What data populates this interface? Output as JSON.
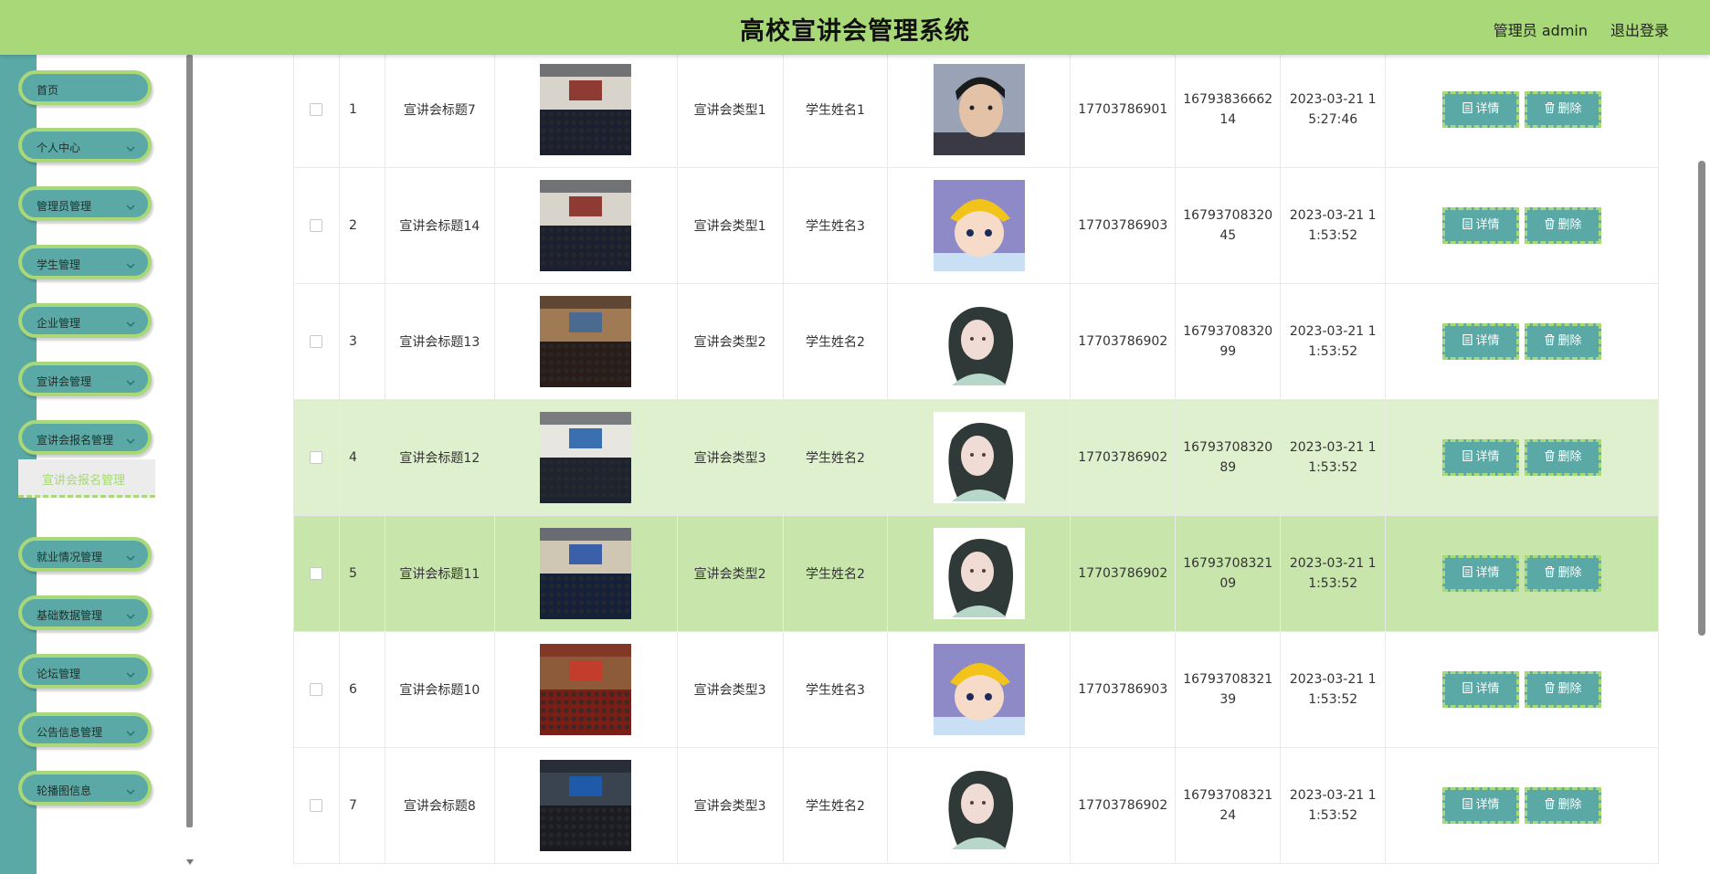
{
  "header": {
    "title": "高校宣讲会管理系统",
    "user": "管理员 admin",
    "logout": "退出登录"
  },
  "sidebar": {
    "items": [
      {
        "label": "首页",
        "has_chevron": false
      },
      {
        "label": "个人中心",
        "has_chevron": true
      },
      {
        "label": "管理员管理",
        "has_chevron": true
      },
      {
        "label": "学生管理",
        "has_chevron": true
      },
      {
        "label": "企业管理",
        "has_chevron": true
      },
      {
        "label": "宣讲会管理",
        "has_chevron": true
      },
      {
        "label": "宣讲会报名管理",
        "has_chevron": true
      },
      {
        "label": "就业情况管理",
        "has_chevron": true
      },
      {
        "label": "基础数据管理",
        "has_chevron": true
      },
      {
        "label": "论坛管理",
        "has_chevron": true
      },
      {
        "label": "公告信息管理",
        "has_chevron": true
      },
      {
        "label": "轮播图信息",
        "has_chevron": true
      }
    ],
    "active_submenu": "宣讲会报名管理"
  },
  "table": {
    "rows": [
      {
        "index": "1",
        "title": "宣讲会标题7",
        "type": "宣讲会类型1",
        "student": "学生姓名1",
        "phone": "17703786901",
        "id": "1679383666214",
        "time": "2023-03-21 15:27:46",
        "highlight": "none",
        "venue_image": "auditorium-photo",
        "avatar_image": "young-man-avatar"
      },
      {
        "index": "2",
        "title": "宣讲会标题14",
        "type": "宣讲会类型1",
        "student": "学生姓名3",
        "phone": "17703786903",
        "id": "1679370832045",
        "time": "2023-03-21 11:53:52",
        "highlight": "none",
        "venue_image": "auditorium-photo",
        "avatar_image": "cartoon-boy-yellow-hat-avatar"
      },
      {
        "index": "3",
        "title": "宣讲会标题13",
        "type": "宣讲会类型2",
        "student": "学生姓名2",
        "phone": "17703786902",
        "id": "1679370832099",
        "time": "2023-03-21 11:53:52",
        "highlight": "none",
        "venue_image": "lecture-hall-photo",
        "avatar_image": "anime-girl-avatar"
      },
      {
        "index": "4",
        "title": "宣讲会标题12",
        "type": "宣讲会类型3",
        "student": "学生姓名2",
        "phone": "17703786902",
        "id": "1679370832089",
        "time": "2023-03-21 11:53:52",
        "highlight": "light",
        "venue_image": "crowded-hall-photo",
        "avatar_image": "anime-girl-avatar"
      },
      {
        "index": "5",
        "title": "宣讲会标题11",
        "type": "宣讲会类型2",
        "student": "学生姓名2",
        "phone": "17703786902",
        "id": "1679370832109",
        "time": "2023-03-21 11:53:52",
        "highlight": "strong",
        "venue_image": "large-auditorium-photo",
        "avatar_image": "anime-girl-avatar"
      },
      {
        "index": "6",
        "title": "宣讲会标题10",
        "type": "宣讲会类型3",
        "student": "学生姓名3",
        "phone": "17703786903",
        "id": "1679370832139",
        "time": "2023-03-21 11:53:52",
        "highlight": "none",
        "venue_image": "red-seats-hall-photo",
        "avatar_image": "cartoon-boy-yellow-hat-avatar"
      },
      {
        "index": "7",
        "title": "宣讲会标题8",
        "type": "宣讲会类型3",
        "student": "学生姓名2",
        "phone": "17703786902",
        "id": "1679370832124",
        "time": "2023-03-21 11:53:52",
        "highlight": "none",
        "venue_image": "stage-banner-photo",
        "avatar_image": "anime-girl-avatar"
      }
    ],
    "detail_label": "详情",
    "delete_label": "删除"
  },
  "colors": {
    "header_bg": "#a8d878",
    "sidebar_teal": "#5aa9a7",
    "row_highlight_light": "#dff0cf",
    "row_highlight_strong": "#c8e6ab"
  }
}
